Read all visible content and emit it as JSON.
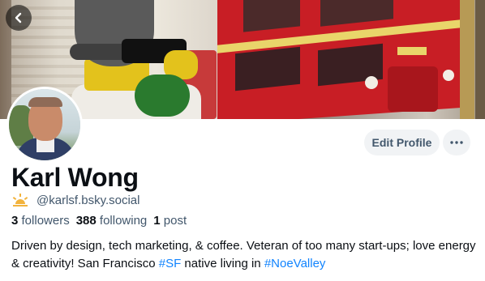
{
  "header": {
    "back_icon": "chevron-left-icon"
  },
  "profile": {
    "display_name": "Karl Wong",
    "handle": "@karlsf.bsky.social",
    "handle_icon": "sun-icon"
  },
  "actions": {
    "edit_profile_label": "Edit Profile",
    "more_icon": "more-horizontal-icon"
  },
  "stats": {
    "followers_count": "3",
    "followers_label": "followers",
    "following_count": "388",
    "following_label": "following",
    "posts_count": "1",
    "posts_label": "post"
  },
  "bio": {
    "part1": "Driven by design, tech marketing, & coffee. Veteran of too many start-ups; love energy & creativity! San Francisco ",
    "tag1": "#SF",
    "part2": " native living in ",
    "tag2": "#NoeValley"
  },
  "colors": {
    "link": "#1083fe",
    "muted_text": "#42576c",
    "button_bg": "#f1f3f5",
    "sun_icon": "#f2b33d"
  }
}
